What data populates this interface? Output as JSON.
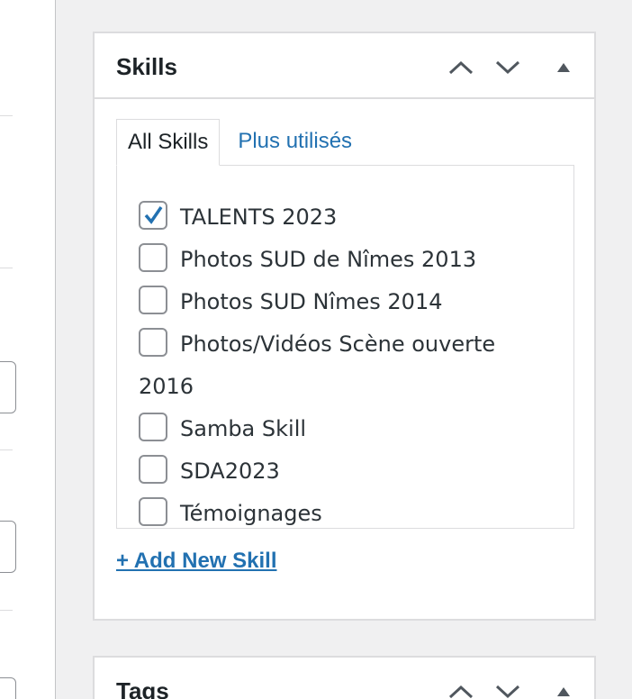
{
  "skills_box": {
    "title": "Skills",
    "tabs": [
      {
        "label": "All Skills",
        "active": true
      },
      {
        "label": "Plus utilisés",
        "active": false
      }
    ],
    "items": [
      {
        "label": "TALENTS 2023",
        "checked": true
      },
      {
        "label": "Photos SUD de Nîmes 2013",
        "checked": false
      },
      {
        "label": "Photos SUD Nîmes 2014",
        "checked": false
      },
      {
        "label": "Photos/Vidéos Scène ouverte 2016",
        "checked": false
      },
      {
        "label": "Samba Skill",
        "checked": false
      },
      {
        "label": "SDA2023",
        "checked": false
      },
      {
        "label": "Témoignages",
        "checked": false
      }
    ],
    "add_new_label": "+ Add New Skill"
  },
  "tags_box": {
    "title": "Tags"
  },
  "icons": {
    "move_up": "chevron-up-icon",
    "move_down": "chevron-down-icon",
    "toggle": "triangle-up-icon"
  },
  "colors": {
    "link": "#2271b1",
    "check": "#2271b1",
    "border": "#dcdcde",
    "background": "#f0f0f1"
  }
}
